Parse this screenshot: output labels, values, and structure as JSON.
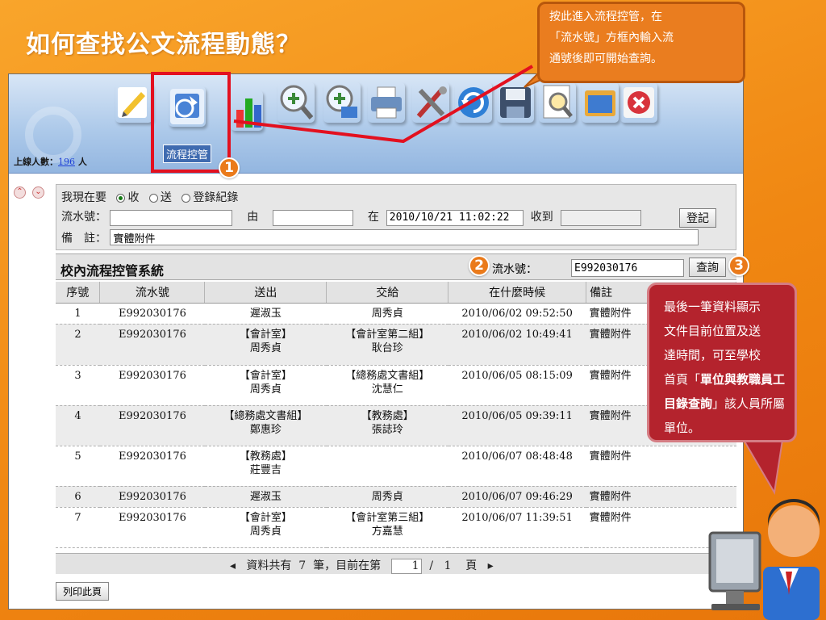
{
  "slide": {
    "title": "如何查找公文流程動態？"
  },
  "callouts": {
    "top": [
      "按此進入流程控管，在",
      "「流水號」方框內輸入流",
      "通號後即可開始查詢。"
    ],
    "bottom_lines": [
      "最後一筆資料顯示",
      "文件目前位置及送",
      "達時間，可至學校"
    ],
    "bottom_pre": "首頁「",
    "bottom_bold": "單位與教職員工目錄查詢",
    "bottom_post": "」該人員所屬單位。",
    "markers": [
      "1",
      "2",
      "3"
    ]
  },
  "toolbar": {
    "online_label": "上線人數：",
    "online_count": "196",
    "online_unit": "人",
    "active_label": "流程控管",
    "icons": [
      "edit-icon",
      "workflow-icon",
      "chart-icon",
      "zoom-in-icon",
      "zoom-search-icon",
      "printer-icon",
      "tools-icon",
      "refresh-icon",
      "save-icon",
      "preview-icon",
      "folder-icon",
      "close-icon"
    ]
  },
  "form": {
    "mode_label": "我現在要",
    "mode_options": [
      "收",
      "送",
      "登錄紀錄"
    ],
    "mode_selected": "收",
    "serial_label": "流水號：",
    "from_label": "由",
    "at_label": "在",
    "datetime_value": "2010/10/21 11:02:22",
    "receive_label": "收到",
    "register_button": "登記",
    "note_label": "備　註：",
    "note_value": "實體附件"
  },
  "system": {
    "title": "校內流程控管系統",
    "serial_label": "流水號：",
    "serial_value": "E992030176",
    "query_button": "查詢"
  },
  "table": {
    "headers": [
      "序號",
      "流水號",
      "送出",
      "交給",
      "在什麼時候",
      "備註"
    ],
    "rows": [
      {
        "no": "1",
        "serial": "E992030176",
        "from1": "遲淑玉",
        "from2": "",
        "to1": "周秀貞",
        "to2": "",
        "time": "2010/06/02 09:52:50",
        "note": "實體附件"
      },
      {
        "no": "2",
        "serial": "E992030176",
        "from1": "【會計室】",
        "from2": "周秀貞",
        "to1": "【會計室第二組】",
        "to2": "耿台珍",
        "time": "2010/06/02 10:49:41",
        "note": "實體附件"
      },
      {
        "no": "3",
        "serial": "E992030176",
        "from1": "【會計室】",
        "from2": "周秀貞",
        "to1": "【總務處文書組】",
        "to2": "沈慧仁",
        "time": "2010/06/05 08:15:09",
        "note": "實體附件"
      },
      {
        "no": "4",
        "serial": "E992030176",
        "from1": "【總務處文書組】",
        "from2": "鄭惠珍",
        "to1": "【教務處】",
        "to2": "張誌玲",
        "time": "2010/06/05 09:39:11",
        "note": "實體附件"
      },
      {
        "no": "5",
        "serial": "E992030176",
        "from1": "【教務處】",
        "from2": "莊豐吉",
        "to1": "",
        "to2": "",
        "time": "2010/06/07 08:48:48",
        "note": "實體附件"
      },
      {
        "no": "6",
        "serial": "E992030176",
        "from1": "遲淑玉",
        "from2": "",
        "to1": "周秀貞",
        "to2": "",
        "time": "2010/06/07 09:46:29",
        "note": "實體附件"
      },
      {
        "no": "7",
        "serial": "E992030176",
        "from1": "【會計室】",
        "from2": "周秀貞",
        "to1": "【會計室第三組】",
        "to2": "方嘉慧",
        "time": "2010/06/07 11:39:51",
        "note": "實體附件"
      }
    ]
  },
  "pager": {
    "text_pre": "資料共有",
    "total": "7",
    "text_mid": "筆，目前在第",
    "page": "1",
    "sep": "/",
    "pages": "1",
    "text_post": "頁"
  },
  "print_button": "列印此頁",
  "colors": {
    "background": "#f08712",
    "toolbar": "#aecaea",
    "highlight_box": "#e3101f",
    "callout_orange": "#ea7d1f",
    "callout_red": "#b4232d"
  }
}
